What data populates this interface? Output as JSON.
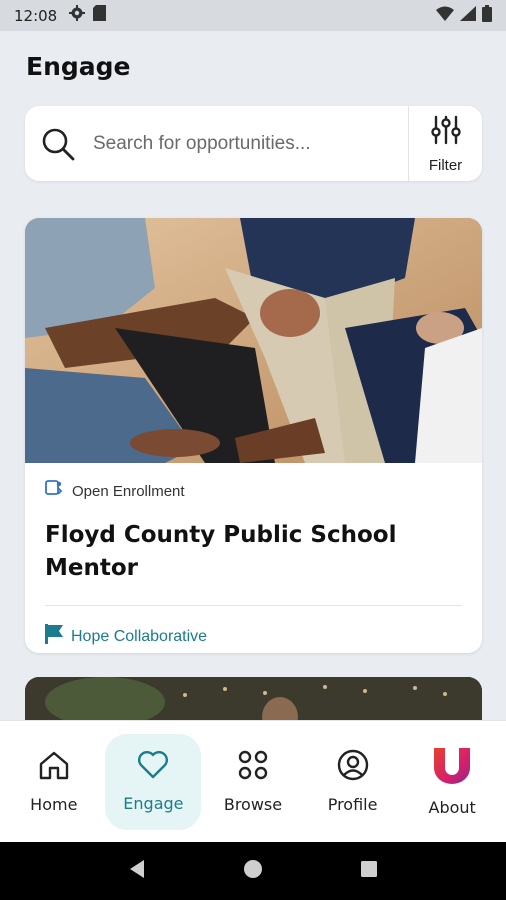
{
  "status_bar": {
    "time": "12:08",
    "left_icons": [
      "gear-icon",
      "sim-card-icon"
    ],
    "right_icons": [
      "wifi-icon",
      "signal-icon",
      "battery-icon"
    ]
  },
  "page": {
    "title": "Engage"
  },
  "search": {
    "placeholder": "Search for opportunities...",
    "value": "",
    "filter_label": "Filter"
  },
  "opportunities": [
    {
      "status": "Open Enrollment",
      "title": "Floyd County Public School Mentor",
      "organization": "Hope Collaborative"
    }
  ],
  "bottom_nav": {
    "items": [
      {
        "label": "Home",
        "icon": "home-icon",
        "active": false
      },
      {
        "label": "Engage",
        "icon": "heart-icon",
        "active": true
      },
      {
        "label": "Browse",
        "icon": "grid-icon",
        "active": false
      },
      {
        "label": "Profile",
        "icon": "profile-icon",
        "active": false
      },
      {
        "label": "About",
        "icon": "about-logo-icon",
        "active": false
      }
    ]
  },
  "colors": {
    "accent": "#1a7c8c",
    "active_bg": "#e5f4f4",
    "background": "#e9edf2"
  }
}
